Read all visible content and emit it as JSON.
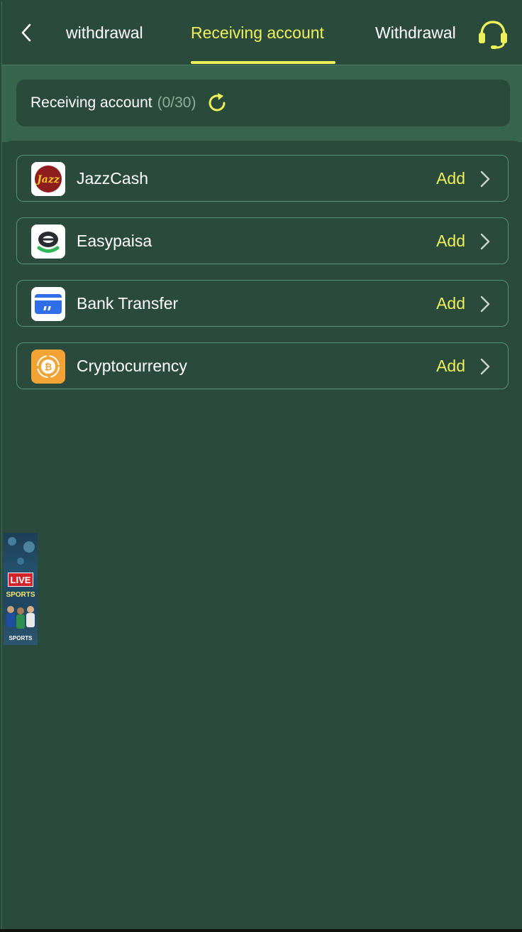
{
  "header": {
    "tabs": [
      {
        "label": "withdrawal"
      },
      {
        "label": "Receiving account"
      },
      {
        "label": "Withdrawal"
      }
    ],
    "active_tab_index": 1
  },
  "summary": {
    "label": "Receiving account",
    "count": "(0/30)"
  },
  "methods": [
    {
      "name": "JazzCash",
      "action": "Add",
      "icon": "jazzcash-logo-icon"
    },
    {
      "name": "Easypaisa",
      "action": "Add",
      "icon": "easypaisa-logo-icon"
    },
    {
      "name": "Bank Transfer",
      "action": "Add",
      "icon": "bank-card-icon"
    },
    {
      "name": "Cryptocurrency",
      "action": "Add",
      "icon": "bitcoin-icon"
    }
  ],
  "float_ad": {
    "badge": "LIVE",
    "text": "SPORTS",
    "footer": "SPORTS"
  },
  "colors": {
    "background": "#2a4b3b",
    "accent": "#eef05a",
    "border": "#5a9373",
    "strip": "#38654d"
  }
}
